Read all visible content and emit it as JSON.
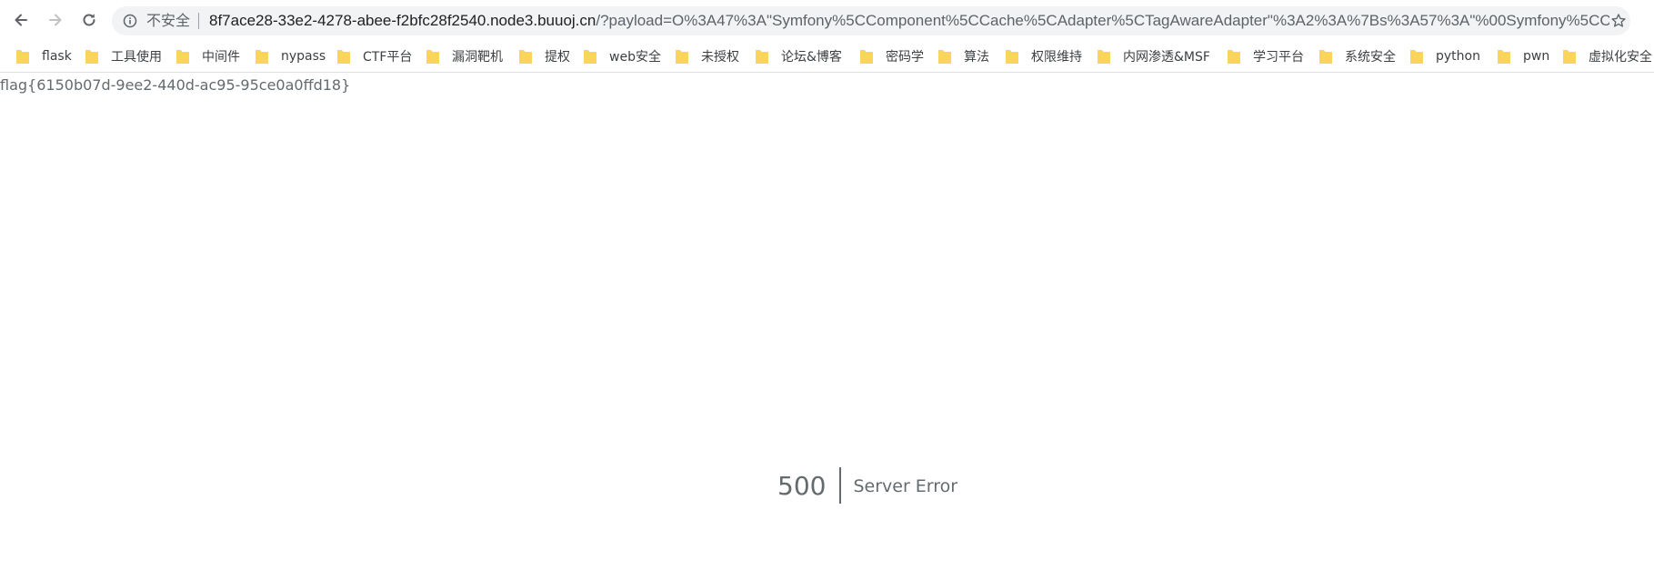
{
  "browser": {
    "security_label": "不安全",
    "url_host": "8f7ace28-33e2-4278-abee-f2bfc28f2540.node3.buuoj.cn",
    "url_path": "/?payload=O%3A47%3A\"Symfony%5CComponent%5CCache%5CAdapter%5CTagAwareAdapter\"%3A2%3A%7Bs%3A57%3A\"%00Symfony%5CC..."
  },
  "bookmarks": [
    {
      "label": "flask",
      "icon": "folder-icon"
    },
    {
      "label": "工具使用",
      "icon": "folder-icon"
    },
    {
      "label": "中间件",
      "icon": "folder-icon"
    },
    {
      "label": "nypass",
      "icon": "folder-icon"
    },
    {
      "label": "CTF平台",
      "icon": "folder-icon"
    },
    {
      "label": "漏洞靶机",
      "icon": "folder-icon"
    },
    {
      "label": "提权",
      "icon": "folder-icon"
    },
    {
      "label": "web安全",
      "icon": "folder-icon"
    },
    {
      "label": "未授权",
      "icon": "folder-icon"
    },
    {
      "label": "论坛&博客",
      "icon": "folder-icon"
    },
    {
      "label": "密码学",
      "icon": "folder-icon"
    },
    {
      "label": "算法",
      "icon": "folder-icon"
    },
    {
      "label": "权限维持",
      "icon": "folder-icon"
    },
    {
      "label": "内网渗透&MSF",
      "icon": "folder-icon"
    },
    {
      "label": "学习平台",
      "icon": "folder-icon"
    },
    {
      "label": "系统安全",
      "icon": "folder-icon"
    },
    {
      "label": "python",
      "icon": "folder-icon"
    },
    {
      "label": "pwn",
      "icon": "folder-icon"
    },
    {
      "label": "虚拟化安全",
      "icon": "folder-icon"
    }
  ],
  "page": {
    "flag": "flag{6150b07d-9ee2-440d-ac95-95ce0a0ffd18}",
    "error_code": "500",
    "error_message": "Server Error"
  },
  "colors": {
    "folder": "#f9d65b",
    "text_gray": "#636b6f",
    "omnibox_bg": "#f1f3f4"
  }
}
